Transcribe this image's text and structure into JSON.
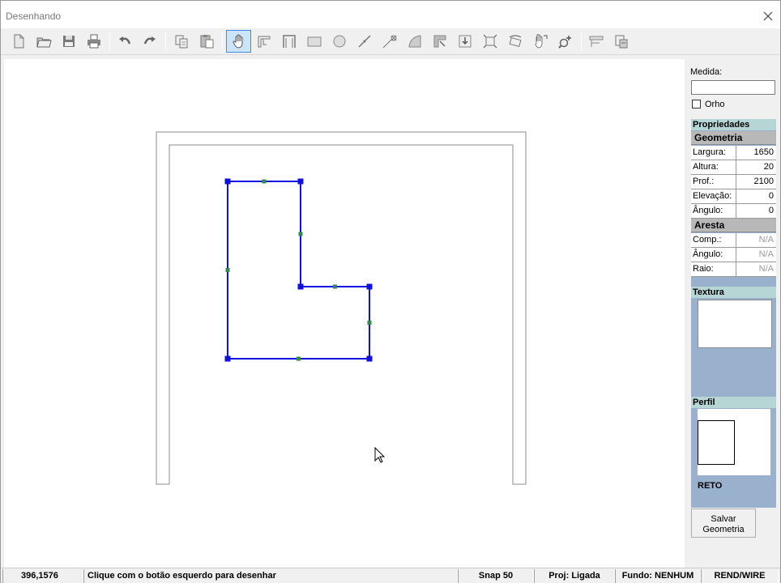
{
  "window": {
    "title": "Desenhando"
  },
  "toolbar": {
    "items": [
      {
        "name": "new-file",
        "icon": "new-file-icon"
      },
      {
        "name": "open-file",
        "icon": "open-folder-icon"
      },
      {
        "name": "save",
        "icon": "save-icon"
      },
      {
        "name": "print",
        "icon": "print-icon"
      },
      {
        "name": "undo",
        "icon": "undo-icon"
      },
      {
        "name": "redo",
        "icon": "redo-icon"
      },
      {
        "name": "copy",
        "icon": "copy-icon"
      },
      {
        "name": "paste",
        "icon": "paste-icon"
      },
      {
        "name": "pan",
        "icon": "hand-icon"
      },
      {
        "name": "stair",
        "icon": "stair-icon"
      },
      {
        "name": "frame",
        "icon": "frame-icon"
      },
      {
        "name": "rectangle",
        "icon": "rectangle-icon"
      },
      {
        "name": "circle",
        "icon": "circle-icon"
      },
      {
        "name": "line",
        "icon": "line-icon"
      },
      {
        "name": "cut-line",
        "icon": "scissors-icon"
      },
      {
        "name": "arc",
        "icon": "arc-icon"
      },
      {
        "name": "corner",
        "icon": "corner-icon"
      },
      {
        "name": "insert",
        "icon": "insert-icon"
      },
      {
        "name": "resize",
        "icon": "resize-icon"
      },
      {
        "name": "rotate",
        "icon": "rotate-icon"
      },
      {
        "name": "move",
        "icon": "move-hand-icon"
      },
      {
        "name": "zoom",
        "icon": "zoom-icon"
      },
      {
        "name": "shelf",
        "icon": "shelf-icon"
      },
      {
        "name": "export",
        "icon": "export-icon"
      }
    ],
    "active": "pan"
  },
  "panel": {
    "medida_label": "Medida:",
    "medida_value": "",
    "orho_label": "Orho",
    "orho_checked": false,
    "propriedades_title": "Propriedades",
    "geometria_title": "Geometria",
    "geometria_rows": [
      {
        "label": "Largura:",
        "value": "1650"
      },
      {
        "label": "Altura:",
        "value": "20"
      },
      {
        "label": "Prof.:",
        "value": "2100"
      },
      {
        "label": "Elevação:",
        "value": "0"
      },
      {
        "label": "Ângulo:",
        "value": "0"
      }
    ],
    "aresta_title": "Aresta",
    "aresta_rows": [
      {
        "label": "Comp.:",
        "value": "N/A"
      },
      {
        "label": "Ângulo:",
        "value": "N/A"
      },
      {
        "label": "Raio:",
        "value": "N/A"
      }
    ],
    "textura_title": "Textura",
    "perfil_title": "Perfil",
    "perfil_value": "RETO",
    "save_label_line1": "Salvar",
    "save_label_line2": "Geometria"
  },
  "statusbar": {
    "coords": "396,1576",
    "hint": "Clique com o botão esquerdo para desenhar",
    "snap": "Snap 50",
    "proj": "Proj: Ligada",
    "fundo": "Fundo: NENHUM",
    "rend": "REND/WIRE"
  },
  "colors": {
    "shape_stroke": "#1010e0",
    "vertex_handle": "#1010e0",
    "mid_handle": "#2e8b57",
    "panel_bg": "#99b1cc",
    "section_header": "#b6d6d6"
  }
}
